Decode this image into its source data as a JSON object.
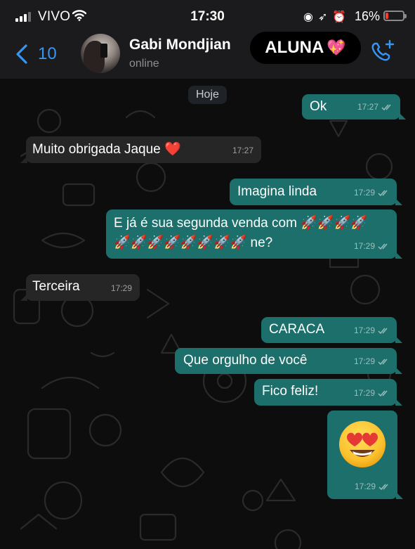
{
  "status_bar": {
    "carrier": "VIVO",
    "time": "17:30",
    "battery_percent": "16%",
    "battery_level": 0.16,
    "icons": [
      "signal-icon",
      "wifi-icon",
      "screen-lock-icon",
      "location-icon",
      "alarm-icon",
      "battery-icon"
    ]
  },
  "header": {
    "back_count": "10",
    "contact_name": "Gabi Mondjian",
    "contact_status": "online",
    "label": "ALUNA",
    "label_emoji": "💖"
  },
  "chat": {
    "day": "Hoje",
    "messages": [
      {
        "dir": "out",
        "text": "Ok",
        "time": "17:27"
      },
      {
        "dir": "in",
        "text": "Muito obrigada Jaque ❤️",
        "time": "17:27"
      },
      {
        "dir": "out",
        "text": "Imagina linda",
        "time": "17:29"
      },
      {
        "dir": "out",
        "text": "E já é sua segunda venda com 🚀🚀🚀🚀",
        "text_line2": "🚀🚀🚀🚀🚀🚀🚀🚀 ne?",
        "time": "17:29"
      },
      {
        "dir": "in",
        "text": "Terceira",
        "time": "17:29"
      },
      {
        "dir": "out",
        "text": "CARACA",
        "time": "17:29"
      },
      {
        "dir": "out",
        "text": "Que orgulho de você",
        "time": "17:29"
      },
      {
        "dir": "out",
        "text": "Fico feliz!",
        "time": "17:29"
      },
      {
        "dir": "out",
        "text": "😍",
        "time": "17:29",
        "emoji_only": true
      }
    ]
  },
  "colors": {
    "outgoing_bubble": "#1c6f6b",
    "incoming_bubble": "#262626",
    "accent_blue": "#3796f4",
    "battery_low": "#ff3b30"
  }
}
